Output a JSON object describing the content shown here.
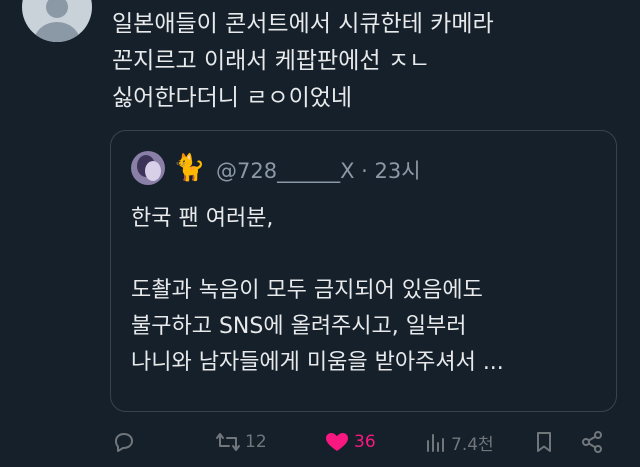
{
  "tweet": {
    "author_partial": "· · · ·",
    "lines": [
      "일본애들이 콘서트에서 시큐한테 카메라",
      "꼰지르고 이래서 케팝판에선 ㅈㄴ",
      "싫어한다더니 ㄹㅇ이었네"
    ]
  },
  "quote": {
    "emoji": "🐈",
    "handle": "@728______X",
    "time": "· 23시",
    "body": [
      "한국 팬 여러분,",
      "",
      " 도촬과 녹음이 모두 금지되어 있음에도",
      "불구하고 SNS에 올려주시고, 일부러",
      "나니와 남자들에게 미움을 받아주셔서 ..."
    ]
  },
  "actions": {
    "reply_icon": "reply-icon",
    "retweet_icon": "retweet-icon",
    "retweet_count": "12",
    "like_icon": "heart-filled-icon",
    "like_count": "36",
    "like_color": "#f91880",
    "views_icon": "views-chart-icon",
    "views_count": "7.4천",
    "bookmark_icon": "bookmark-icon",
    "share_icon": "share-icon"
  },
  "colors": {
    "background": "#15202b",
    "text": "#e7e9ea",
    "muted": "#71767b",
    "border": "#38444d"
  }
}
